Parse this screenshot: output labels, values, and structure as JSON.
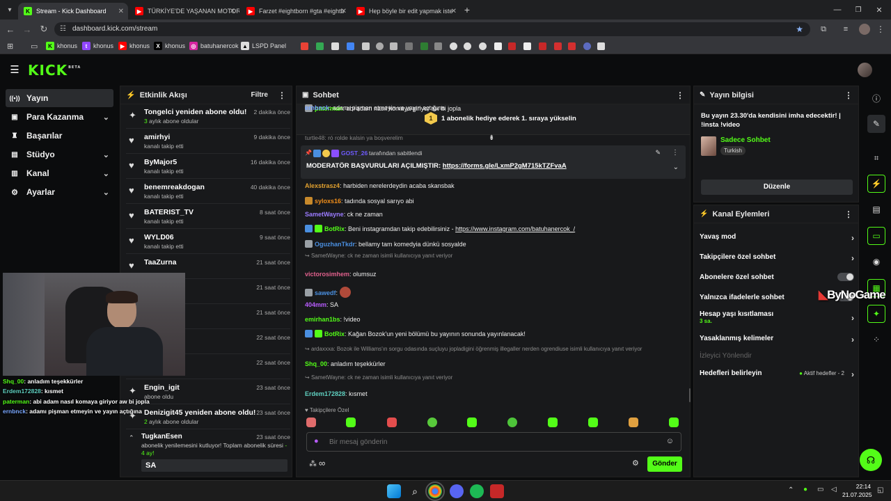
{
  "browser": {
    "tabs": [
      {
        "title": "Stream - Kick Dashboard",
        "favicon": "kick-icon",
        "active": true
      },
      {
        "title": "TÜRKİYE'DE YAŞANAN MOTOR",
        "favicon": "youtube-icon",
        "active": false
      },
      {
        "title": "Farzet #eightborn #gta #eightb",
        "favicon": "youtube-icon",
        "active": false
      },
      {
        "title": "Hep böyle bir edit yapmak iste",
        "favicon": "youtube-icon",
        "active": false
      }
    ],
    "url": "dashboard.kick.com/stream",
    "bookmarks": [
      {
        "label": "khonus",
        "icon": "kick-icon"
      },
      {
        "label": "khonus",
        "icon": "twitch-icon"
      },
      {
        "label": "khonus",
        "icon": "youtube-icon"
      },
      {
        "label": "khonus",
        "icon": "x-icon"
      },
      {
        "label": "batuhanercok",
        "icon": "instagram-icon"
      },
      {
        "label": "LSPD Panel",
        "icon": "lspd-icon"
      }
    ]
  },
  "kick": {
    "logo": "KICK",
    "logo_beta": "BETA",
    "brand_color": "#53fc18",
    "sidenav": [
      {
        "label": "Yayın",
        "icon": "broadcast-icon",
        "active": true,
        "expandable": false
      },
      {
        "label": "Para Kazanma",
        "icon": "wallet-icon",
        "active": false,
        "expandable": true
      },
      {
        "label": "Başarılar",
        "icon": "trophy-icon",
        "active": false,
        "expandable": false
      },
      {
        "label": "Stüdyo",
        "icon": "studio-icon",
        "active": false,
        "expandable": true
      },
      {
        "label": "Kanal",
        "icon": "channel-icon",
        "active": false,
        "expandable": true
      },
      {
        "label": "Ayarlar",
        "icon": "settings-icon",
        "active": false,
        "expandable": true
      }
    ]
  },
  "activity": {
    "title": "Etkinlik Akışı",
    "filter_label": "Filtre",
    "items": [
      {
        "name": "Tongelci yeniden abone oldu!",
        "sub_prefix": "3",
        "sub": "aylık abone oldular",
        "time": "2 dakika önce",
        "icon": "sparkle-icon"
      },
      {
        "name": "amirhyi",
        "sub_prefix": "",
        "sub": "kanalı takip etti",
        "time": "9 dakika önce",
        "icon": "heart-icon"
      },
      {
        "name": "ByMajor5",
        "sub_prefix": "",
        "sub": "kanalı takip etti",
        "time": "16 dakika önce",
        "icon": "heart-icon"
      },
      {
        "name": "benemreakdogan",
        "sub_prefix": "",
        "sub": "kanalı takip etti",
        "time": "40 dakika önce",
        "icon": "heart-icon"
      },
      {
        "name": "BATERIST_TV",
        "sub_prefix": "",
        "sub": "kanalı takip etti",
        "time": "8 saat önce",
        "icon": "heart-icon"
      },
      {
        "name": "WYLD06",
        "sub_prefix": "",
        "sub": "kanalı takip etti",
        "time": "9 saat önce",
        "icon": "heart-icon"
      },
      {
        "name": "TaaZurna",
        "sub_prefix": "",
        "sub": "",
        "time": "21 saat önce",
        "icon": "heart-icon"
      },
      {
        "name": "",
        "sub_prefix": "",
        "sub": "",
        "time": "21 saat önce",
        "icon": "heart-icon"
      },
      {
        "name": "",
        "sub_prefix": "",
        "sub": "",
        "time": "21 saat önce",
        "icon": "heart-icon"
      },
      {
        "name": "",
        "sub_prefix": "",
        "sub": "",
        "time": "22 saat önce",
        "icon": "heart-icon"
      },
      {
        "name": "",
        "sub_prefix": "",
        "sub": "",
        "time": "22 saat önce",
        "icon": "heart-icon"
      },
      {
        "name": "Engin_igit",
        "sub_prefix": "",
        "sub": "abone oldu",
        "time": "23 saat önce",
        "icon": "sparkle-icon"
      },
      {
        "name": "Denizigit45 yeniden abone oldu!",
        "sub_prefix": "2",
        "sub": "aylık abone oldular",
        "time": "23 saat önce",
        "icon": "sparkle-icon"
      }
    ],
    "last": {
      "name": "TugkanEsen",
      "time": "23 saat önce",
      "text": "abonelik yenilemesini kutluyor! Toplam abonelik süresi",
      "months": "- 4 ay!",
      "quote": "SA"
    }
  },
  "chat": {
    "title": "Sohbet",
    "gift_banner": "1 abonelik hediye ederek 1. sıraya yükselin",
    "gift_rank": "1",
    "pinned": {
      "by": "GOST_26",
      "by_suffix": "tarafından sabitlendi",
      "text": "MODERATÖR BAŞVURULARI AÇILMIŞTIR:",
      "link": "https://forms.gle/LxmP2gM715kTZFvaA"
    },
    "partial_top": "turtle48: ró rolde kalsin ya boşverelim",
    "messages": [
      {
        "user": "Alexstrasz4",
        "text": "harbiden nerelerdeydin acaba skansbak",
        "color": "#e2a12f",
        "badges": []
      },
      {
        "user": "syloxs16",
        "text": "tadında sosyal sarıyo abi",
        "color": "#f28f1a",
        "badges": [
          "#c7892b"
        ]
      },
      {
        "user": "SametWayne",
        "text": "ck ne zaman",
        "color": "#9b7bff",
        "badges": []
      },
      {
        "user": "BotRix",
        "text": "Beni instagramdan takip edebilirsiniz - ",
        "link": "https://www.instagram.com/batuhanercok_/",
        "color": "#53fc18",
        "badges": [
          "#4a8fe0",
          "#53fc18"
        ]
      },
      {
        "user": "OguzhanTkdr",
        "text": "bellamy tam komedyia dünkü sosyalde",
        "color": "#4a8fe0",
        "badges": [
          "#9aa0a6"
        ]
      },
      {
        "reply": "SametWayne: ck ne zaman isimli kullanıcıya yanıt veriyor",
        "user": "victorosimhem",
        "text": "olumsuz",
        "color": "#e0608c",
        "badges": []
      },
      {
        "user": "sawedf",
        "text": "",
        "color": "#4a8fe0",
        "badges": [
          "#9aa0a6"
        ],
        "emote": true
      },
      {
        "user": "404mm",
        "text": "SA",
        "color": "#b85cff",
        "badges": []
      },
      {
        "user": "emirhan1bs",
        "text": "!video",
        "color": "#53fc18",
        "badges": []
      },
      {
        "user": "BotRix",
        "text": "Kağan Bozok'un yeni bölümü bu yayının sonunda yayınlanacak!",
        "color": "#53fc18",
        "badges": [
          "#4a8fe0",
          "#53fc18"
        ]
      },
      {
        "reply": "ardaxxxa: Bozok ile Williams'ın sorgu odasında suçluyu jopladigini öğrenmiş illegaller nerden ogrendiuse isimli kullanıcıya yanıt veriyor",
        "user": "Shq_00",
        "text": "anladım teşekkürler",
        "color": "#53fc18",
        "badges": []
      },
      {
        "reply": "SametWayne: ck ne zaman isimli kullanıcıya yanıt veriyor",
        "user": "Erdem172828",
        "text": "kısmet",
        "color": "#5fd0c0",
        "badges": []
      },
      {
        "user": "paterman",
        "text": "abi adam nasıl komaya giriyor aw bi jopla",
        "color": "#53fc18",
        "badges": [
          "#9aa0a6"
        ]
      },
      {
        "user": "ernbnck",
        "text": "adamı pişman etmeyin ve yayın açtığına",
        "color": "#7aa7ff",
        "badges": []
      }
    ],
    "emote_section": "Takipçilere Özel",
    "input_placeholder": "Bir mesaj gönderin",
    "send_label": "Gönder"
  },
  "stream_info": {
    "title": "Yayın bilgisi",
    "stream_title": "Bu yayın 23.30'da kendisini imha edecektir! | !insta !video",
    "category": "Sadece Sohbet",
    "language": "Turkish",
    "edit_label": "Düzenle"
  },
  "channel_actions": {
    "title": "Kanal Eylemleri",
    "items": [
      {
        "label": "Yavaş mod",
        "type": "chevron"
      },
      {
        "label": "Takipçilere özel sohbet",
        "type": "chevron"
      },
      {
        "label": "Abonelere özel sohbet",
        "type": "toggle"
      },
      {
        "label": "Yalnızca ifadelerle sohbet",
        "type": "toggle"
      },
      {
        "label": "Hesap yaşı kısıtlaması",
        "sub": "3 sa.",
        "type": "chevron"
      },
      {
        "label": "Yasaklanmış kelimeler",
        "type": "chevron"
      },
      {
        "label": "İzleyici Yönlendir",
        "type": "disabled"
      },
      {
        "label": "Hedefleri belirleyin",
        "status": "Aktif hedefler - 2",
        "type": "chevron"
      }
    ]
  },
  "webcam_overlay": {
    "lines": [
      {
        "user": "Shq_00",
        "text": "anladım teşekkürler",
        "color": "#53fc18"
      },
      {
        "user": "Erdem172828",
        "text": "kısmet",
        "color": "#5fd0c0"
      },
      {
        "user": "paterman",
        "text": "abi adam nasıl komaya giriyor aw bi jopla",
        "color": "#53fc18"
      },
      {
        "user": "ernbnck",
        "text": "adamı pişman etmeyin ve yayın açtığına",
        "color": "#7aa7ff"
      }
    ]
  },
  "watermark": "ByNoGame",
  "taskbar": {
    "time": "22:14",
    "date": "21.07.2025"
  }
}
